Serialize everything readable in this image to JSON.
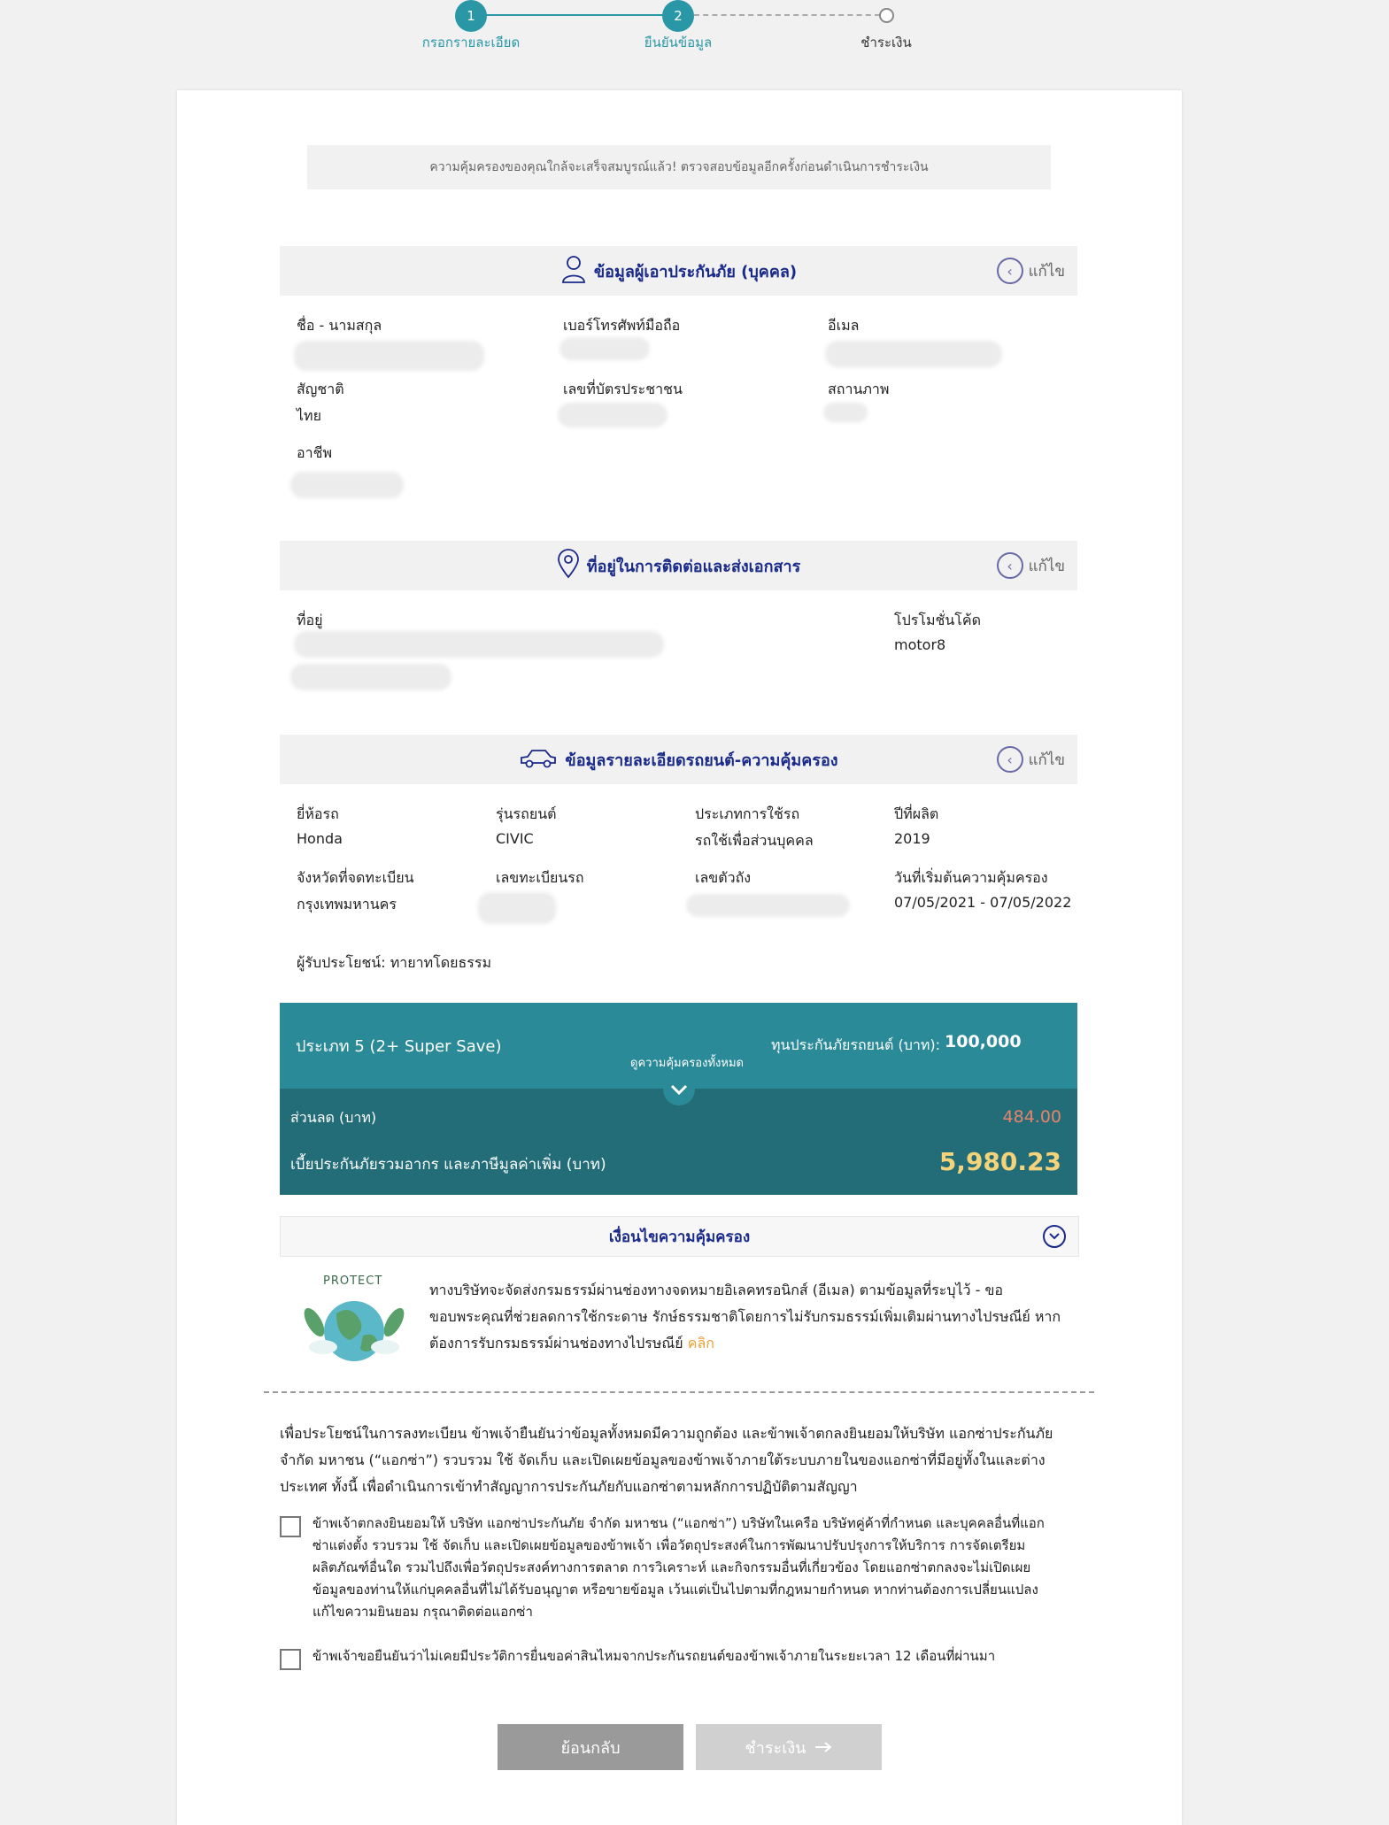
{
  "stepper": {
    "steps": [
      {
        "number": "1",
        "label": "กรอกรายละเอียด"
      },
      {
        "number": "2",
        "label": "ยืนยันข้อมูล"
      },
      {
        "number": "",
        "label": "ชำระเงิน"
      }
    ]
  },
  "notice": "ความคุ้มครองของคุณใกล้จะเสร็จสมบูรณ์แล้ว! ตรวจสอบข้อมูลอีกครั้งก่อนดำเนินการชำระเงิน",
  "edit_label": "แก้ไข",
  "insured": {
    "title": "ข้อมูลผู้เอาประกันภัย (บุคคล)",
    "name_label": "ชื่อ - นามสกุล",
    "phone_label": "เบอร์โทรศัพท์มือถือ",
    "email_label": "อีเมล",
    "nationality_label": "สัญชาติ",
    "nationality_value": "ไทย",
    "id_label": "เลขที่บัตรประชาชน",
    "status_label": "สถานภาพ",
    "occupation_label": "อาชีพ"
  },
  "address": {
    "title": "ที่อยู่ในการติดต่อและส่งเอกสาร",
    "address_label": "ที่อยู่",
    "promo_label": "โปรโมชั่นโค้ด",
    "promo_value": "motor8"
  },
  "vehicle": {
    "title": "ข้อมูลรายละเอียดรถยนต์-ความคุ้มครอง",
    "brand_label": "ยี่ห้อรถ",
    "brand_value": "Honda",
    "model_label": "รุ่นรถยนต์",
    "model_value": "CIVIC",
    "usage_label": "ประเภทการใช้รถ",
    "usage_value": "รถใช้เพื่อส่วนบุคคล",
    "year_label": "ปีที่ผลิต",
    "year_value": "2019",
    "province_label": "จังหวัดที่จดทะเบียน",
    "province_value": "กรุงเทพมหานคร",
    "plate_label": "เลขทะเบียนรถ",
    "chassis_label": "เลขตัวถัง",
    "period_label": "วันที่เริ่มต้นความคุ้มครอง",
    "period_value": "07/05/2021 - 07/05/2022",
    "beneficiary": "ผู้รับประโยชน์: ทายาทโดยธรรม"
  },
  "plan": {
    "name": "ประเภท 5 (2+ Super Save)",
    "view_all": "ดูความคุ้มครองทั้งหมด",
    "sum_label": "ทุนประกันภัยรถยนต์ (บาท):",
    "sum_value": "100,000",
    "discount_label": "ส่วนลด (บาท)",
    "discount_value": "484.00",
    "premium_label": "เบี้ยประกันภัยรวมอากร และภาษีมูลค่าเพิ่ม (บาท)",
    "premium_value": "5,980.23"
  },
  "conditions": {
    "title": "เงื่อนไขความคุ้มครอง"
  },
  "protect": {
    "badge": "PROTECT",
    "text": "ทางบริษัทจะจัดส่งกรมธรรม์ผ่านช่องทางจดหมายอิเลคทรอนิกส์ (อีเมล) ตามข้อมูลที่ระบุไว้ - ขอขอบพระคุณที่ช่วยลดการใช้กระดาษ รักษ์ธรรมชาติโดยการไม่รับกรมธรรม์เพิ่มเติมผ่านทางไปรษณีย์ หากต้องการรับกรมธรรม์ผ่านช่องทางไปรษณีย์",
    "link": "คลิก"
  },
  "consent": {
    "main": "เพื่อประโยชน์ในการลงทะเบียน ข้าพเจ้ายืนยันว่าข้อมูลทั้งหมดมีความถูกต้อง และข้าพเจ้าตกลงยินยอมให้บริษัท แอกซ่าประกันภัย จำกัด มหาชน (“แอกซ่า”) รวบรวม ใช้ จัดเก็บ และเปิดเผยข้อมูลของข้าพเจ้าภายใต้ระบบภายในของแอกซ่าที่มีอยู่ทั้งในและต่างประเทศ ทั้งนี้ เพื่อดำเนินการเข้าทำสัญญาการประกันภัยกับแอกซ่าตามหลักการปฏิบัติตามสัญญา",
    "check1": "ข้าพเจ้าตกลงยินยอมให้ บริษัท แอกซ่าประกันภัย จำกัด มหาชน (“แอกซ่า”) บริษัทในเครือ บริษัทคู่ค้าที่กำหนด และบุคคลอื่นที่แอกซ่าแต่งตั้ง รวบรวม ใช้ จัดเก็บ และเปิดเผยข้อมูลของข้าพเจ้า เพื่อวัตถุประสงค์ในการพัฒนาปรับปรุงการให้บริการ การจัดเตรียมผลิตภัณฑ์อื่นใด รวมไปถึงเพื่อวัตถุประสงค์ทางการตลาด การวิเคราะห์ และกิจกรรมอื่นที่เกี่ยวข้อง โดยแอกซ่าตกลงจะไม่เปิดเผยข้อมูลของท่านให้แก่บุคคลอื่นที่ไม่ได้รับอนุญาต หรือขายข้อมูล เว้นแต่เป็นไปตามที่กฎหมายกำหนด หากท่านต้องการเปลี่ยนแปลงแก้ไขความยินยอม กรุณาติดต่อแอกซ่า",
    "check2": "ข้าพเจ้าขอยืนยันว่าไม่เคยมีประวัติการยื่นขอค่าสินไหมจากประกันรถยนต์ของข้าพเจ้าภายในระยะเวลา 12 เดือนที่ผ่านมา"
  },
  "buttons": {
    "back": "ย้อนกลับ",
    "pay": "ชำระเงิน"
  },
  "colors": {
    "teal": "#2a97a6",
    "navy": "#1a2a8a",
    "discount": "#e8836b",
    "premium": "#f5d37a"
  }
}
